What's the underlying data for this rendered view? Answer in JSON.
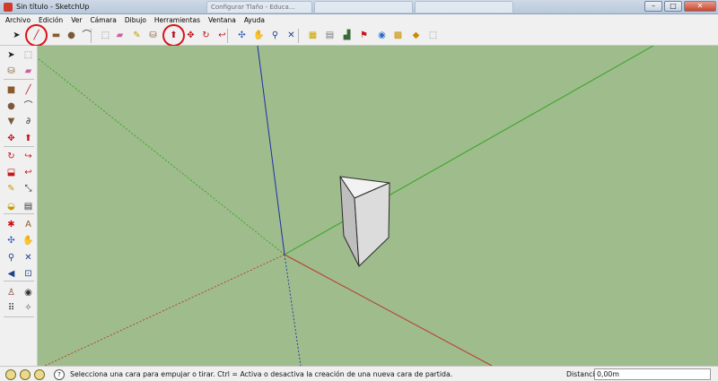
{
  "window": {
    "title": "Sin título - SketchUp",
    "background_tabs": [
      "Configurar Tlaño - Educa…",
      "",
      ""
    ],
    "controls": {
      "minimize": "–",
      "maximize": "□",
      "close": "✕"
    }
  },
  "menubar": {
    "items": [
      "Archivo",
      "Edición",
      "Ver",
      "Cámara",
      "Dibujo",
      "Herramientas",
      "Ventana",
      "Ayuda"
    ]
  },
  "toolbar_top": {
    "tools": [
      {
        "name": "select-tool",
        "icon": "arrow-icon",
        "glyph": "➤",
        "color": "#222222"
      },
      {
        "name": "line-tool",
        "icon": "pencil-icon",
        "glyph": "╱",
        "color": "#b5121b",
        "highlighted": true
      },
      {
        "name": "rectangle-tool",
        "icon": "rectangle-icon",
        "glyph": "▬",
        "color": "#8a5a2a"
      },
      {
        "name": "circle-tool",
        "icon": "circle-icon",
        "glyph": "●",
        "color": "#7a5a3a"
      },
      {
        "name": "arc-tool",
        "icon": "arc-icon",
        "glyph": "⌒",
        "color": "#333333"
      },
      {
        "name": "make-component-tool",
        "icon": "component-icon",
        "glyph": "⬚",
        "color": "#777777"
      },
      {
        "name": "eraser-tool",
        "icon": "eraser-icon",
        "glyph": "▰",
        "color": "#d0609a"
      },
      {
        "name": "tape-measure-tool",
        "icon": "tape-icon",
        "glyph": "✎",
        "color": "#c49a00"
      },
      {
        "name": "paint-bucket-tool",
        "icon": "bucket-icon",
        "glyph": "⛁",
        "color": "#8a5a2a"
      },
      {
        "name": "push-pull-tool",
        "icon": "push-pull-icon",
        "glyph": "⬆",
        "color": "#b5121b",
        "highlighted": true
      },
      {
        "name": "move-tool",
        "icon": "move-icon",
        "glyph": "✥",
        "color": "#c8141b"
      },
      {
        "name": "rotate-tool",
        "icon": "rotate-icon",
        "glyph": "↻",
        "color": "#c8141b"
      },
      {
        "name": "offset-tool",
        "icon": "offset-icon",
        "glyph": "↩",
        "color": "#c8141b"
      },
      {
        "name": "orbit-tool",
        "icon": "orbit-icon",
        "glyph": "✣",
        "color": "#2a55b8"
      },
      {
        "name": "pan-tool",
        "icon": "hand-icon",
        "glyph": "✋",
        "color": "#555555"
      },
      {
        "name": "zoom-tool",
        "icon": "magnifier-icon",
        "glyph": "⚲",
        "color": "#1e3f8a"
      },
      {
        "name": "zoom-extents-tool",
        "icon": "zoom-extents-icon",
        "glyph": "✕",
        "color": "#1e3f8a"
      },
      {
        "name": "get-models-tool",
        "icon": "warehouse-icon",
        "glyph": "▦",
        "color": "#c9a200"
      },
      {
        "name": "share-model-tool",
        "icon": "share-icon",
        "glyph": "▤",
        "color": "#777777"
      },
      {
        "name": "get-photo-texture-tool",
        "icon": "photo-icon",
        "glyph": "▟",
        "color": "#3a6a3a"
      },
      {
        "name": "add-location-tool",
        "icon": "location-icon",
        "glyph": "⚑",
        "color": "#c8141b"
      },
      {
        "name": "toggle-terrain-tool",
        "icon": "globe-icon",
        "glyph": "◉",
        "color": "#2a6ac8"
      },
      {
        "name": "photo-textures-tool",
        "icon": "camera-icon",
        "glyph": "▩",
        "color": "#c99000"
      },
      {
        "name": "extension-warehouse-tool",
        "icon": "extension-icon",
        "glyph": "◆",
        "color": "#c98a00"
      },
      {
        "name": "send-to-layout-tool",
        "icon": "layout-icon",
        "glyph": "⬚",
        "color": "#888888"
      }
    ]
  },
  "toolbar_left": {
    "tools": [
      {
        "name": "select-tool",
        "icon": "arrow-icon",
        "glyph": "➤",
        "color": "#222222"
      },
      {
        "name": "make-component-tool",
        "icon": "component-icon",
        "glyph": "⬚",
        "color": "#777777"
      },
      {
        "name": "paint-bucket-tool",
        "icon": "bucket-icon",
        "glyph": "⛁",
        "color": "#8a5a2a"
      },
      {
        "name": "eraser-tool",
        "icon": "eraser-icon",
        "glyph": "▰",
        "color": "#d0609a"
      },
      {
        "name": "rectangle-tool",
        "icon": "rectangle-icon",
        "glyph": "■",
        "color": "#8a5a2a"
      },
      {
        "name": "line-tool",
        "icon": "pencil-icon",
        "glyph": "╱",
        "color": "#b5121b"
      },
      {
        "name": "circle-tool",
        "icon": "circle-icon",
        "glyph": "●",
        "color": "#7a5a3a"
      },
      {
        "name": "arc-tool",
        "icon": "arc-icon",
        "glyph": "⌒",
        "color": "#333333"
      },
      {
        "name": "polygon-tool",
        "icon": "polygon-icon",
        "glyph": "▼",
        "color": "#7a5a3a"
      },
      {
        "name": "freehand-tool",
        "icon": "freehand-icon",
        "glyph": "∂",
        "color": "#333333"
      },
      {
        "name": "move-tool",
        "icon": "move-icon",
        "glyph": "✥",
        "color": "#c8141b"
      },
      {
        "name": "push-pull-tool",
        "icon": "push-pull-icon",
        "glyph": "⬆",
        "color": "#b5121b"
      },
      {
        "name": "rotate-tool",
        "icon": "rotate-icon",
        "glyph": "↻",
        "color": "#c8141b"
      },
      {
        "name": "follow-me-tool",
        "icon": "follow-me-icon",
        "glyph": "↪",
        "color": "#c8141b"
      },
      {
        "name": "scale-tool",
        "icon": "scale-icon",
        "glyph": "⬓",
        "color": "#c8141b"
      },
      {
        "name": "offset-tool",
        "icon": "offset-icon",
        "glyph": "↩",
        "color": "#c8141b"
      },
      {
        "name": "tape-measure-tool",
        "icon": "tape-icon",
        "glyph": "✎",
        "color": "#c49a00"
      },
      {
        "name": "dimension-tool",
        "icon": "dimension-icon",
        "glyph": "⤡",
        "color": "#333333"
      },
      {
        "name": "protractor-tool",
        "icon": "protractor-icon",
        "glyph": "◒",
        "color": "#c49a00"
      },
      {
        "name": "text-tool",
        "icon": "text-icon",
        "glyph": "▤",
        "color": "#333333"
      },
      {
        "name": "axes-tool",
        "icon": "axes-icon",
        "glyph": "✱",
        "color": "#c8141b"
      },
      {
        "name": "3d-text-tool",
        "icon": "3d-text-icon",
        "glyph": "A",
        "color": "#8a5a2a"
      },
      {
        "name": "orbit-tool",
        "icon": "orbit-icon",
        "glyph": "✣",
        "color": "#2a55b8"
      },
      {
        "name": "pan-tool",
        "icon": "hand-icon",
        "glyph": "✋",
        "color": "#555555"
      },
      {
        "name": "zoom-tool",
        "icon": "magnifier-icon",
        "glyph": "⚲",
        "color": "#1e3f8a"
      },
      {
        "name": "zoom-extents-tool",
        "icon": "zoom-extents-icon",
        "glyph": "✕",
        "color": "#1e3f8a"
      },
      {
        "name": "previous-view-tool",
        "icon": "previous-view-icon",
        "glyph": "◀",
        "color": "#1e3f8a"
      },
      {
        "name": "zoom-window-tool",
        "icon": "zoom-window-icon",
        "glyph": "⊡",
        "color": "#1e3f8a"
      },
      {
        "name": "position-camera-tool",
        "icon": "person-icon",
        "glyph": "♙",
        "color": "#7a3a2a"
      },
      {
        "name": "look-around-tool",
        "icon": "eye-icon",
        "glyph": "◉",
        "color": "#333333"
      },
      {
        "name": "walk-tool",
        "icon": "footprints-icon",
        "glyph": "⠿",
        "color": "#111111"
      },
      {
        "name": "section-plane-tool",
        "icon": "section-plane-icon",
        "glyph": "✧",
        "color": "#555555"
      }
    ]
  },
  "viewport": {
    "axis_colors": {
      "red": "#b73a2a",
      "green": "#2fa51f",
      "blue": "#1c2fa8"
    },
    "face_colors": {
      "light": "#f2f2f2",
      "mid": "#dcdcdc",
      "dark": "#bebebe",
      "edge": "#2b2b2b"
    }
  },
  "statusbar": {
    "icons": [
      "geo-icon",
      "credits-icon",
      "user-icon",
      "help-icon"
    ],
    "help_glyph": "?",
    "message": "Selecciona una cara para empujar o tirar. Ctrl = Activa o desactiva la creación de una nueva cara de partida.",
    "measurement_label": "Distancia",
    "measurement_value": "0,00m"
  }
}
